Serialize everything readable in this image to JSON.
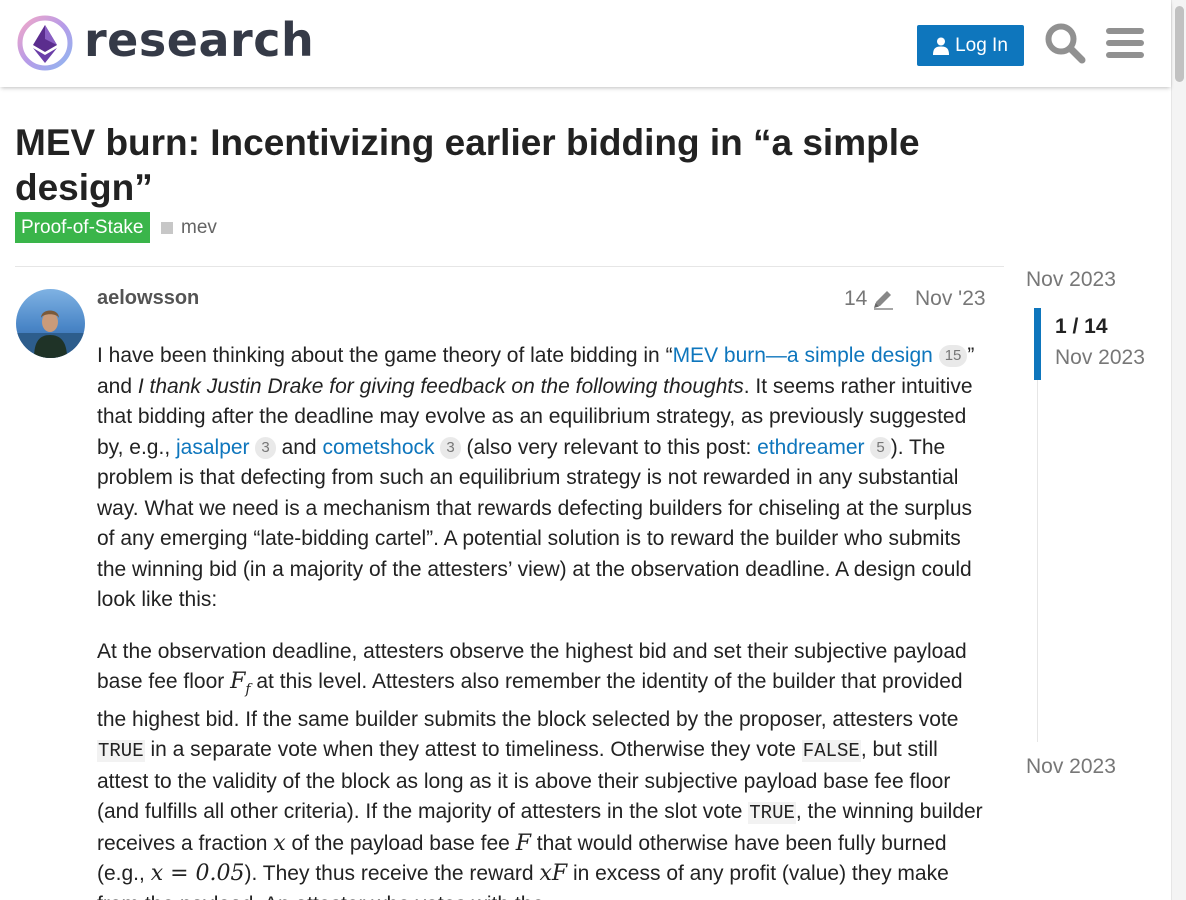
{
  "header": {
    "brand": "research",
    "login_label": "Log In"
  },
  "topic": {
    "title": "MEV burn: Incentivizing earlier bidding in “a simple design”",
    "category": "Proof-of-Stake",
    "category_color": "#3ab54a",
    "tag": "mev"
  },
  "post": {
    "username": "aelowsson",
    "edit_count": "14",
    "date": "Nov '23",
    "p1": {
      "t1": "I have been thinking about the game theory of late bidding in “",
      "link1": "MEV burn—a simple design",
      "link1_count": "15",
      "t2": "” and ",
      "italic": "I thank Justin Drake for giving feedback on the following thoughts",
      "t3": ". It seems rather intuitive that bidding after the deadline may evolve as an equilibrium strategy, as previously suggested by, e.g., ",
      "link2": "jasalper",
      "link2_count": "3",
      "t4": " and ",
      "link3": "cometshock",
      "link3_count": "3",
      "t5": " (also very relevant to this post: ",
      "link4": "ethdreamer",
      "link4_count": "5",
      "t6": "). The problem is that defecting from such an equilibrium strategy is not rewarded in any substantial way. What we need is a mechanism that rewards defecting builders for chiseling at the surplus of any emerging “late-bidding cartel”. A potential solution is to reward the builder who submits the winning bid (in a majority of the attesters’ view) at the observation deadline. A design could look like this:"
    },
    "p2": {
      "t1": "At the observation deadline, attesters observe the highest bid and set their subjective payload base fee floor ",
      "m1": "F",
      "m1_sub": "f",
      "t2": " at this level. Attesters also remember the identity of the builder that provided the highest bid. If the same builder submits the block selected by the proposer, attesters vote ",
      "code1": "TRUE",
      "t3": " in a separate vote when they attest to timeliness. Otherwise they vote ",
      "code2": "FALSE",
      "t4": ", but still attest to the validity of the block as long as it is above their subjective payload base fee floor (and fulfills all other criteria). If the majority of attesters in the slot vote ",
      "code3": "TRUE",
      "t5": ", the winning builder receives a fraction ",
      "m2": "x",
      "t6": " of the payload base fee ",
      "m3": "F",
      "t7": " that would otherwise have been fully burned (e.g., ",
      "m4": "x = 0.05",
      "t8": "). They thus receive the reward ",
      "m5": "xF",
      "t9": " in excess of any profit (value) they make from the payload. An attester who votes with the"
    }
  },
  "timeline": {
    "start_date": "Nov 2023",
    "position": "1 / 14",
    "position_date": "Nov 2023",
    "end_date": "Nov 2023"
  }
}
